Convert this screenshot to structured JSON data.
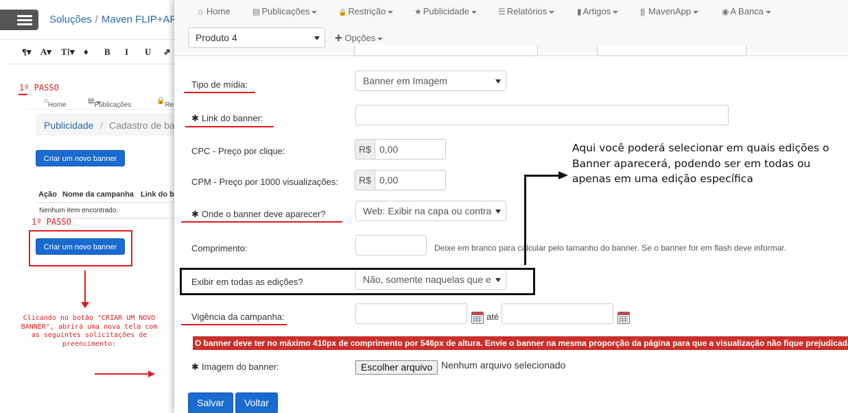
{
  "background": {
    "breadcrumb": {
      "root": "Soluções",
      "separator": "/",
      "current": "Maven FLIP+APK"
    },
    "editor_toolbar": [
      "¶▾",
      "A▾",
      "T⁞▾",
      "♦",
      "B",
      "I",
      "U",
      "⇗"
    ],
    "step_label": "1º PASSO",
    "mini_nav": {
      "home": "Home",
      "publicacoes": "Publicações",
      "restricao": "Res"
    },
    "mini_breadcrumb": {
      "root": "Publicidade",
      "separator": "/",
      "current": "Cadastro de ba"
    },
    "create_button": "Criar um novo banner",
    "table_headers": [
      "Ação",
      "Nome da campanha",
      "Link do ba"
    ],
    "empty_message": "Nenhum item encontrado.",
    "annotation": "Clicando no botão \"CRIAR UM NOVO BANNER\", abrirá uma nova tela com as seguintes solicitações de preencimento:"
  },
  "nav": {
    "items": [
      {
        "icon": "home-icon",
        "glyph": "⌂",
        "label": "Home",
        "dropdown": false
      },
      {
        "icon": "file-icon",
        "glyph": "▤",
        "label": "Publicações",
        "dropdown": true
      },
      {
        "icon": "lock-icon",
        "glyph": "🔒",
        "label": "Restrição",
        "dropdown": true
      },
      {
        "icon": "star-icon",
        "glyph": "★",
        "label": "Publicidade",
        "dropdown": true
      },
      {
        "icon": "list-icon",
        "glyph": "☰",
        "label": "Relatórios",
        "dropdown": true
      },
      {
        "icon": "bookmark-icon",
        "glyph": "▮",
        "label": "Artigos",
        "dropdown": true
      },
      {
        "icon": "barcode-icon",
        "glyph": "|||",
        "label": "MavenApp",
        "dropdown": true
      },
      {
        "icon": "globe-icon",
        "glyph": "◉",
        "label": "A Banca",
        "dropdown": true
      }
    ],
    "product_select": "Produto 4",
    "options": {
      "icon": "plus-icon",
      "glyph": "✚",
      "label": "Opções"
    }
  },
  "form": {
    "tipo_midia": {
      "label": "Tipo de mídia:",
      "value": "Banner em Imagem"
    },
    "link_banner": {
      "label": "Link do banner:",
      "value": ""
    },
    "cpc": {
      "label": "CPC - Preço por clique:",
      "addon": "R$",
      "value": "0,00"
    },
    "cpm": {
      "label": "CPM - Preço por 1000 visualizações:",
      "addon": "R$",
      "value": "0,00"
    },
    "onde_aparecer": {
      "label": "Onde o banner deve aparecer?",
      "value": "Web: Exibir na capa ou contra"
    },
    "comprimento": {
      "label": "Comprimento:",
      "value": "",
      "help": "Deixe em branco para calcular pelo tamanho do banner. Se o banner for em flash deve informar."
    },
    "exibir_edicoes": {
      "label": "Exibir em todas as edições?",
      "value": "Não, somente naquelas que e"
    },
    "vigencia": {
      "label": "Vigência da campanha:",
      "start": "",
      "separator": "até",
      "end": ""
    },
    "alert": "O banner deve ter no máximo 410px de comprimento por 546px de altura. Envie o banner na mesma proporção da página para que a visualização não fique prejudicada.",
    "imagem": {
      "label": "Imagem do banner:",
      "button": "Escolher arquivo",
      "status": "Nenhum arquivo selecionado"
    },
    "save_button": "Salvar",
    "back_button": "Voltar"
  },
  "annotation": {
    "text": "Aqui você poderá selecionar em quais edições o Banner aparecerá, podendo ser em todas ou apenas em uma edição específica"
  },
  "colors": {
    "primary": "#1a6bcf",
    "danger": "#c9302c",
    "annotation_red": "#e01b1b",
    "annotation_black": "#111111"
  }
}
